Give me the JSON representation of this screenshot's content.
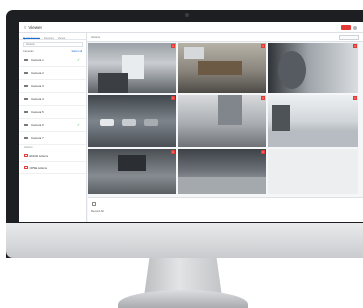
{
  "app": {
    "title": "Viewer",
    "menu_icon": "menu-icon"
  },
  "header": {
    "alert_badge": "",
    "user_icon": "user-icon"
  },
  "sidebar": {
    "tabs": [
      {
        "label": "Quick Access"
      },
      {
        "label": "Devices"
      },
      {
        "label": "Views"
      }
    ],
    "search_value": "Antonis",
    "group": {
      "title": "Cameras",
      "action": "Select all"
    },
    "cameras": [
      {
        "label": "Camera 1",
        "checked": true
      },
      {
        "label": "Camera 2",
        "checked": false
      },
      {
        "label": "Camera 3",
        "checked": false
      },
      {
        "label": "Camera 4",
        "checked": false
      },
      {
        "label": "Camera 5",
        "checked": false
      },
      {
        "label": "Camera 6",
        "checked": true
      },
      {
        "label": "Camera 7",
        "checked": false
      }
    ],
    "actions_label": "Actions",
    "actions": [
      {
        "label": "ENGSI Actions"
      },
      {
        "label": "OPSE Actions"
      }
    ]
  },
  "main": {
    "layout_label": "Antonis",
    "layout_select": ""
  },
  "footer": {
    "text": "Record All"
  },
  "colors": {
    "accent": "#1f6fd1",
    "alert": "#e53935",
    "check": "#4caf50"
  }
}
